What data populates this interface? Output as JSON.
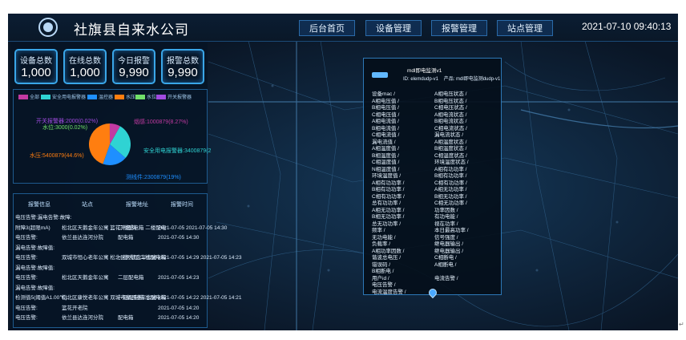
{
  "header": {
    "title": "社旗县自来水公司",
    "nav": [
      "后台首页",
      "设备管理",
      "报警管理",
      "站点管理"
    ],
    "datetime": "2021-07-10 09:40:13"
  },
  "stats": [
    {
      "label": "设备总数",
      "value": "1,000"
    },
    {
      "label": "在线总数",
      "value": "1,000"
    },
    {
      "label": "今日报警",
      "value": "9,990"
    },
    {
      "label": "报警总数",
      "value": "9,990"
    }
  ],
  "chart_data": {
    "type": "pie",
    "legend": [
      {
        "name": "全部",
        "color": "#c23aa2"
      },
      {
        "name": "安全用电报警器",
        "color": "#2fd3d3"
      },
      {
        "name": "温控器",
        "color": "#1e8fff"
      },
      {
        "name": "水压",
        "color": "#ff7e10"
      },
      {
        "name": "水位",
        "color": "#71e06a"
      },
      {
        "name": "开关报警器",
        "color": "#a04be0"
      }
    ],
    "slices": [
      {
        "label": "烟感:1000879(8.27%)",
        "value": 8.27,
        "color": "#c23aa2"
      },
      {
        "label": "安全用电报警器:3400879(2",
        "value": 28.1,
        "color": "#2fd3d3"
      },
      {
        "label": "测线件:2300879(19%)",
        "value": 19.0,
        "color": "#1e8fff"
      },
      {
        "label": "水压:5400879(44.6%)",
        "value": 44.6,
        "color": "#ff7e10"
      },
      {
        "label": "水位:3000(0.02%)",
        "value": 0.02,
        "color": "#71e06a"
      },
      {
        "label": "开关报警器:2000(0.02%)",
        "value": 0.02,
        "color": "#a04be0"
      }
    ]
  },
  "table": {
    "headers": [
      "报警信息",
      "站点",
      "报警地址",
      "报警时间"
    ],
    "rows": [
      [
        "电压告警:漏电告警:故障:",
        "",
        "",
        ""
      ],
      [
        "附障3(超限mA)",
        "松北区天鹅金年公寓 篮花开老院",
        "二楼配电箱 二楼配电",
        "2021-07-05 2021-07-05 14:30"
      ],
      [
        "电压告警:",
        "依兰县达连河分院",
        "配电箱",
        "2021-07-05 14:30"
      ],
      [
        "漏电告警:故障值:",
        "",
        "",
        ""
      ],
      [
        "电压告警:",
        "双城市恒心老年公寓 松北区天鹅金年公寓",
        "一楼大厅 二楼配电箱",
        "2021-07-05 14:29 2021-07-05 14:23"
      ],
      [
        "漏电告警:故障值:",
        "",
        "",
        ""
      ],
      [
        "电压告警:",
        "松北区天鹅金年公寓",
        "二层配电箱",
        "2021-07-05 14:23"
      ],
      [
        "漏电告警:故障值:",
        "",
        "",
        ""
      ],
      [
        "检测值5(阈值A1.00℃)",
        "松北区康悦老年公寓 双城市家园老年公寓",
        "一层配电箱 总配电箱",
        "2021-07-05 14:22 2021-07-05 14:21"
      ],
      [
        "电压告警:",
        "篮花开老院",
        "",
        "2021-07-05 14:20"
      ],
      [
        "电压告警:",
        "依兰县达连河分院",
        "配电箱",
        "2021-07-05 14:20"
      ]
    ]
  },
  "popup": {
    "name": "mdl即电监测v1",
    "id_text": "ID: elemdudp-v1",
    "product_text": "产品: mdl即电监测dudp-v1",
    "props_left": [
      "设备mac",
      "A相电压值",
      "B相电压值",
      "C相电压值",
      "A相电流值",
      "B相电流值",
      "C相电流值",
      "漏电流值",
      "A相温度值",
      "B相温度值",
      "C相温度值",
      "N相温度值",
      "环境温度值",
      "A相有功功率",
      "B相有功功率",
      "C相有功功率",
      "总有功功率",
      "A相无功功率",
      "B相无功功率",
      "总无功功率",
      "频率",
      "无功电能",
      "负载率",
      "A相功率因数",
      "谐波总电压",
      "错误码",
      "B相断电",
      "用户id",
      "电压告警",
      "电流温度告警"
    ],
    "props_right": [
      "A相电压状态",
      "B相电压状态",
      "C相电压状态",
      "A相电流状态",
      "B相电流状态",
      "C相电流状态",
      "漏电流状态",
      "A相温度状态",
      "B相温度状态",
      "C相温度状态",
      "环境温度状态",
      "A相有功功率",
      "B相有功功率",
      "C相有功功率",
      "A相无功功率",
      "B相无功功率",
      "C相无功功率",
      "功率因数",
      "有功电能",
      "视在功率",
      "本日最高功率",
      "信号强度",
      "继电器输出",
      "继电器输出",
      "C相断电",
      "A相断电",
      "",
      "电流告警",
      "",
      ""
    ]
  }
}
